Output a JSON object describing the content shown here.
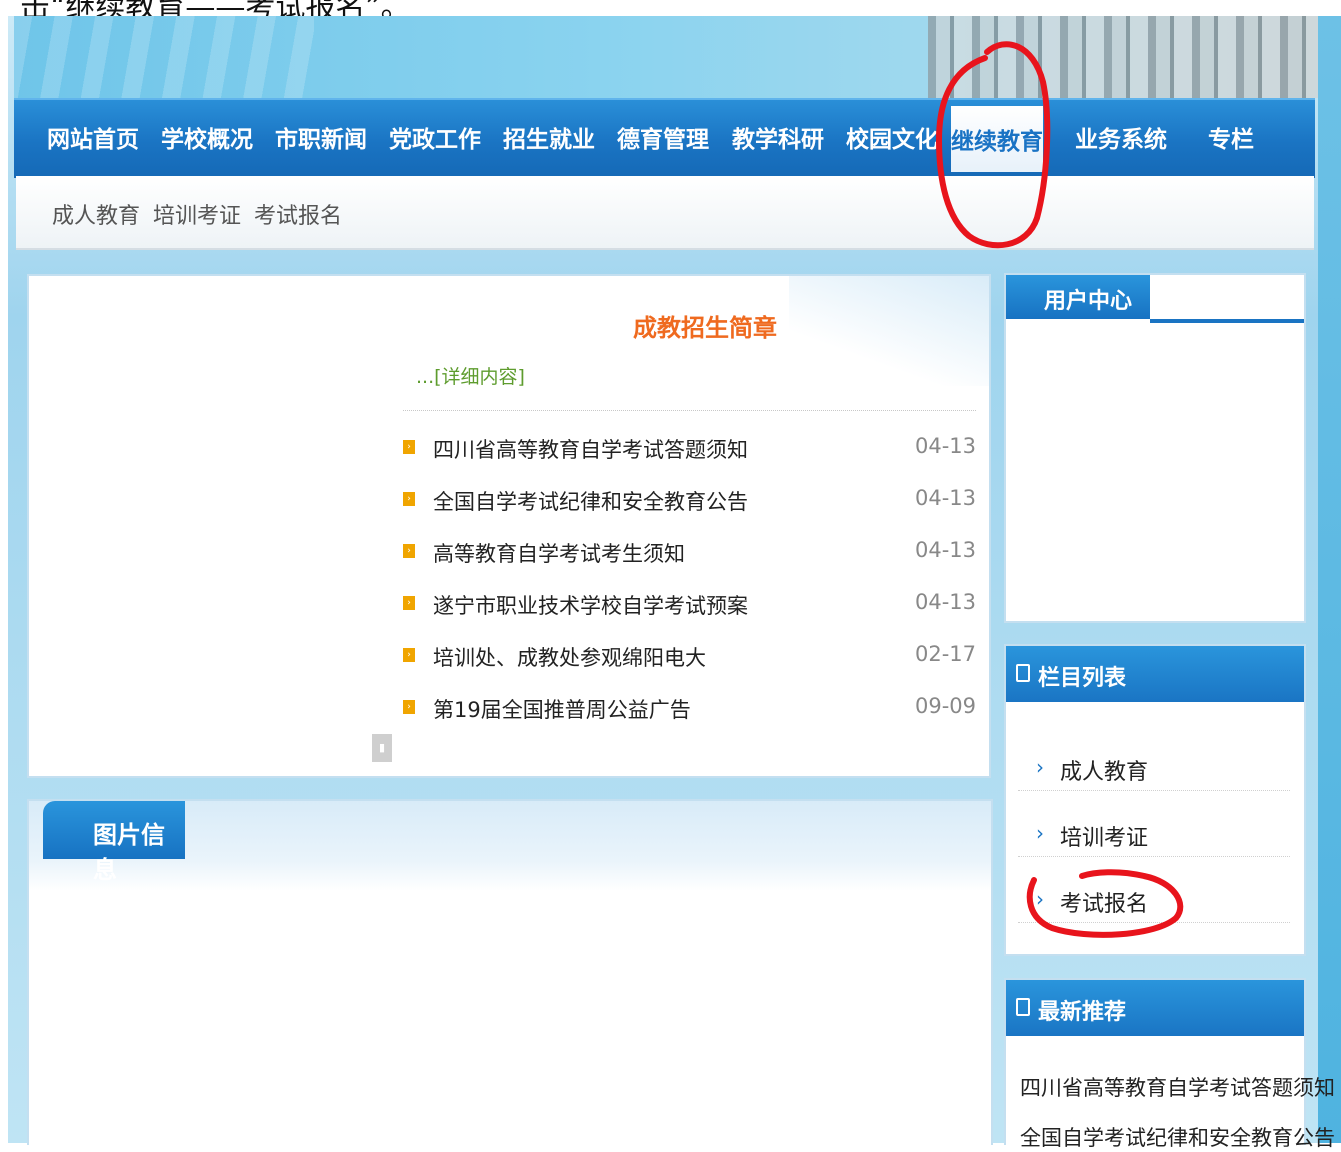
{
  "doc_text": "击“继续教育——考试报名”。",
  "nav": {
    "items": [
      "网站首页",
      "学校概况",
      "市职新闻",
      "党政工作",
      "招生就业",
      "德育管理",
      "教学科研",
      "校园文化",
      "继续教育",
      "业务系统",
      "专栏"
    ],
    "active": "继续教育"
  },
  "subnav": {
    "items": [
      "成人教育",
      "培训考证",
      "考试报名"
    ]
  },
  "feature": {
    "title": "成教招生简章",
    "detail_link": "...[详细内容]"
  },
  "news": [
    {
      "title": "四川省高等教育自学考试答题须知",
      "date": "04-13"
    },
    {
      "title": "全国自学考试纪律和安全教育公告",
      "date": "04-13"
    },
    {
      "title": "高等教育自学考试考生须知",
      "date": "04-13"
    },
    {
      "title": "遂宁市职业技术学校自学考试预案",
      "date": "04-13"
    },
    {
      "title": "培训处、成教处参观绵阳电大",
      "date": "02-17"
    },
    {
      "title": "第19届全国推普周公益广告",
      "date": "09-09"
    }
  ],
  "photo_panel": {
    "title": "图片信息"
  },
  "user_center": {
    "title": "用户中心"
  },
  "column_list": {
    "title": "栏目列表",
    "items": [
      "成人教育",
      "培训考证",
      "考试报名"
    ]
  },
  "recommend": {
    "title": "最新推荐",
    "items": [
      "四川省高等教育自学考试答题须知",
      "全国自学考试纪律和安全教育公告"
    ]
  },
  "colors": {
    "nav_blue": "#1a74c3",
    "title_orange": "#ef6a1f",
    "annotation_red": "#e8141c",
    "link_green": "#5e9c2e"
  }
}
